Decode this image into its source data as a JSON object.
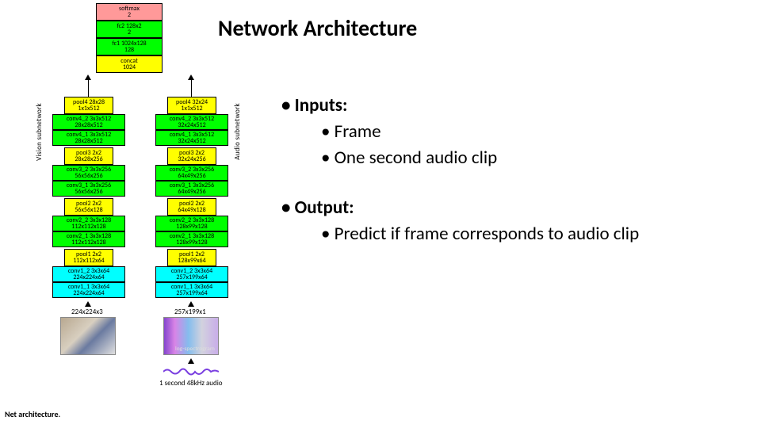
{
  "title": "Network Architecture",
  "bullets": {
    "inputs": {
      "heading": "Inputs:",
      "items": [
        "Frame",
        "One second audio clip"
      ]
    },
    "output": {
      "heading": "Output:",
      "items": [
        "Predict if frame corresponds to audio clip"
      ]
    }
  },
  "top": {
    "softmax": "softmax\n2",
    "fc2": "fc2 128x2\n2",
    "fc1": "fc1 1024x128\n128",
    "concat": "concat\n1024"
  },
  "labels": {
    "vision": "Vision subnetwork",
    "audio": "Audio subnetwork",
    "net_caption": "Net architecture.",
    "frame_size": "224x224x3",
    "spec_size": "257x199x1",
    "spec_label": "log-spectrogram",
    "audio_input": "1 second 48kHz audio"
  },
  "vision": [
    {
      "cls": "yel",
      "t": "pool4 28x28\n1x1x512"
    },
    {
      "cls": "grn",
      "t": "conv4_2 3x3x512\n28x28x512"
    },
    {
      "cls": "grn",
      "t": "conv4_1 3x3x512\n28x28x512"
    },
    {
      "cls": "yel",
      "t": "pool3 2x2\n28x28x256"
    },
    {
      "cls": "grn",
      "t": "conv3_2 3x3x256\n56x56x256"
    },
    {
      "cls": "grn",
      "t": "conv3_1 3x3x256\n56x56x256"
    },
    {
      "cls": "yel",
      "t": "pool2 2x2\n56x56x128"
    },
    {
      "cls": "grn",
      "t": "conv2_2 3x3x128\n112x112x128"
    },
    {
      "cls": "grn",
      "t": "conv2_1 3x3x128\n112x112x128"
    },
    {
      "cls": "yel",
      "t": "pool1 2x2\n112x112x64"
    },
    {
      "cls": "cyn",
      "t": "conv1_2 3x3x64\n224x224x64"
    },
    {
      "cls": "cyn",
      "t": "conv1_1 3x3x64\n224x224x64"
    }
  ],
  "audio": [
    {
      "cls": "yel",
      "t": "pool4 32x24\n1x1x512"
    },
    {
      "cls": "grn",
      "t": "conv4_2 3x3x512\n32x24x512"
    },
    {
      "cls": "grn",
      "t": "conv4_1 3x3x512\n32x24x512"
    },
    {
      "cls": "yel",
      "t": "pool3 2x2\n32x24x256"
    },
    {
      "cls": "grn",
      "t": "conv3_2 3x3x256\n64x49x256"
    },
    {
      "cls": "grn",
      "t": "conv3_1 3x3x256\n64x49x256"
    },
    {
      "cls": "yel",
      "t": "pool2 2x2\n64x49x128"
    },
    {
      "cls": "grn",
      "t": "conv2_2 3x3x128\n128x99x128"
    },
    {
      "cls": "grn",
      "t": "conv2_1 3x3x128\n128x99x128"
    },
    {
      "cls": "yel",
      "t": "pool1 2x2\n128x99x64"
    },
    {
      "cls": "cyn",
      "t": "conv1_2 3x3x64\n257x199x64"
    },
    {
      "cls": "cyn",
      "t": "conv1_1 3x3x64\n257x199x64"
    }
  ]
}
